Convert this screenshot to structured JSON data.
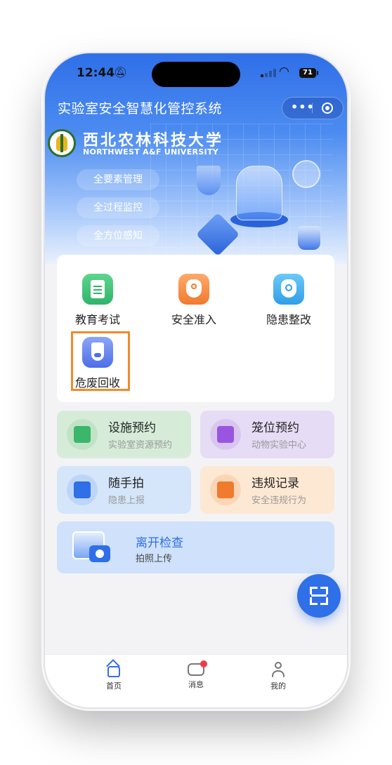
{
  "status": {
    "time": "12:44",
    "battery": "71"
  },
  "app": {
    "title": "实验室安全智慧化管控系统",
    "capsule_more": "•••"
  },
  "banner": {
    "university_cn": "西北农林科技大学",
    "university_en": "NORTHWEST A&F UNIVERSITY",
    "pills": [
      "全要素管理",
      "全过程监控",
      "全方位感知"
    ]
  },
  "grid": {
    "items": [
      {
        "label": "教育考试",
        "icon": "exam-document-icon"
      },
      {
        "label": "安全准入",
        "icon": "shield-key-icon"
      },
      {
        "label": "隐患整改",
        "icon": "shield-search-icon"
      },
      {
        "label": "危废回收",
        "icon": "flask-icon"
      }
    ]
  },
  "tiles": [
    {
      "title": "设施预约",
      "subtitle": "实验室资源预约",
      "icon": "calendar-clock-icon",
      "bg": "#d6ecd9",
      "accent": "#3cb66a"
    },
    {
      "title": "笼位预约",
      "subtitle": "动物实验中心",
      "icon": "calendar-check-icon",
      "bg": "#e6dcf5",
      "accent": "#9a55e0"
    },
    {
      "title": "随手拍",
      "subtitle": "隐患上报",
      "icon": "camera-icon",
      "bg": "#d5e6fb",
      "accent": "#2f6fe8"
    },
    {
      "title": "违规记录",
      "subtitle": "安全违规行为",
      "icon": "warning-document-icon",
      "bg": "#fde8d4",
      "accent": "#f07a2e"
    }
  ],
  "exit": {
    "title": "离开检查",
    "subtitle": "拍照上传"
  },
  "tabbar": {
    "items": [
      {
        "label": "首页",
        "icon": "home-icon",
        "active": true
      },
      {
        "label": "消息",
        "icon": "message-icon",
        "badge": true
      },
      {
        "label": "我的",
        "icon": "user-icon"
      }
    ]
  }
}
